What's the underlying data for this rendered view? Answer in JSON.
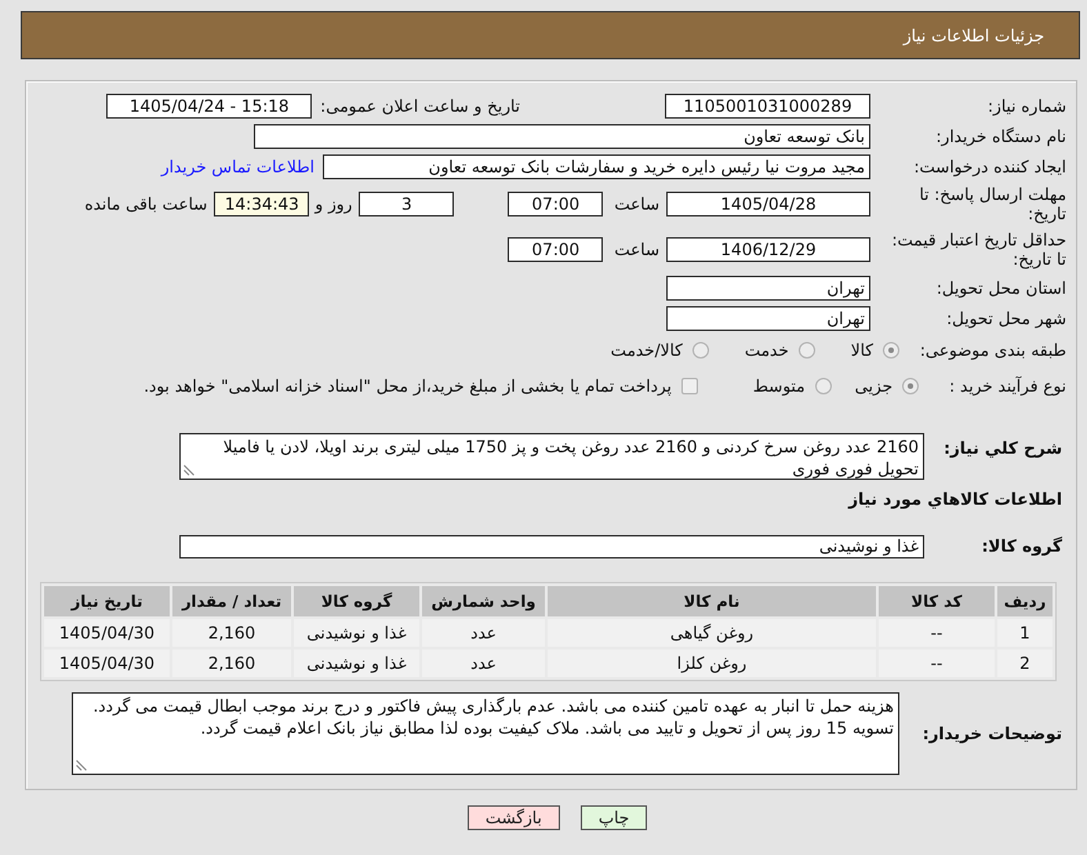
{
  "header": {
    "title": "جزئیات اطلاعات نیاز"
  },
  "details": {
    "need_number": {
      "label": "شماره نیاز:",
      "value": "1105001031000289"
    },
    "announce": {
      "label": "تاریخ و ساعت اعلان عمومی:",
      "value": "1405/04/24 - 15:18"
    },
    "buyer_org": {
      "label": "نام دستگاه خریدار:",
      "value": "بانک توسعه تعاون"
    },
    "requester": {
      "label": "ایجاد کننده درخواست:",
      "value": "مجید مروت نیا رئیس دایره خرید و سفارشات بانک توسعه تعاون",
      "contact_link": "اطلاعات تماس خریدار"
    },
    "reply_deadline": {
      "label": "مهلت ارسال پاسخ: تا تاریخ:",
      "date": "1405/04/28",
      "time_label": "ساعت",
      "time": "07:00",
      "days": "3",
      "days_label": "روز و",
      "remaining": "14:34:43",
      "remaining_label": "ساعت باقی مانده"
    },
    "price_validity": {
      "label": "حداقل تاریخ اعتبار قیمت: تا تاریخ:",
      "date": "1406/12/29",
      "time_label": "ساعت",
      "time": "07:00"
    },
    "province": {
      "label": "استان محل تحویل:",
      "value": "تهران"
    },
    "city": {
      "label": "شهر محل تحویل:",
      "value": "تهران"
    },
    "category": {
      "label": "طبقه بندی موضوعی:",
      "options": [
        {
          "label": "کالا",
          "selected": true,
          "disabled": true
        },
        {
          "label": "خدمت",
          "selected": false,
          "disabled": true
        },
        {
          "label": "کالا/خدمت",
          "selected": false,
          "disabled": true
        }
      ]
    },
    "process": {
      "label": "نوع فرآیند خرید :",
      "options": [
        {
          "label": "جزیی",
          "selected": true,
          "disabled": true
        },
        {
          "label": "متوسط",
          "selected": false,
          "disabled": true
        }
      ],
      "treasury_payment": {
        "label": "پرداخت تمام یا بخشی از مبلغ خرید،از محل \"اسناد خزانه اسلامی\" خواهد بود.",
        "checked": false,
        "disabled": true
      }
    }
  },
  "description": {
    "label": "شرح کلي نیاز:",
    "value": "2160 عدد روغن سرخ کردنی و 2160 عدد روغن پخت و پز 1750 میلی لیتری برند اویلا، لادن یا فامیلا تحویل فوری فوری"
  },
  "goods": {
    "title": "اطلاعات کالاهاي مورد نیاز",
    "group_label": "گروه کالا:",
    "group_value": "غذا و نوشیدنی"
  },
  "table": {
    "columns": [
      "ردیف",
      "کد کالا",
      "نام کالا",
      "واحد شمارش",
      "گروه کالا",
      "تعداد / مقدار",
      "تاریخ نیاز"
    ],
    "rows": [
      [
        "1",
        "--",
        "روغن گیاهی",
        "عدد",
        "غذا و نوشیدنی",
        "2,160",
        "1405/04/30"
      ],
      [
        "2",
        "--",
        "روغن کلزا",
        "عدد",
        "غذا و نوشیدنی",
        "2,160",
        "1405/04/30"
      ]
    ]
  },
  "buyer_notes": {
    "label": "توضیحات خریدار:",
    "value": "هزینه حمل تا انبار به عهده تامین کننده می باشد. عدم بارگذاری پیش فاکتور و درج برند موجب ابطال قیمت می گردد. تسویه 15 روز پس از تحویل و تایید می باشد. ملاک کیفیت بوده لذا مطابق نیاز بانک اعلام قیمت گردد."
  },
  "buttons": [
    {
      "label": "چاپ",
      "kind": "print"
    },
    {
      "label": "بازگشت",
      "kind": "back"
    }
  ]
}
